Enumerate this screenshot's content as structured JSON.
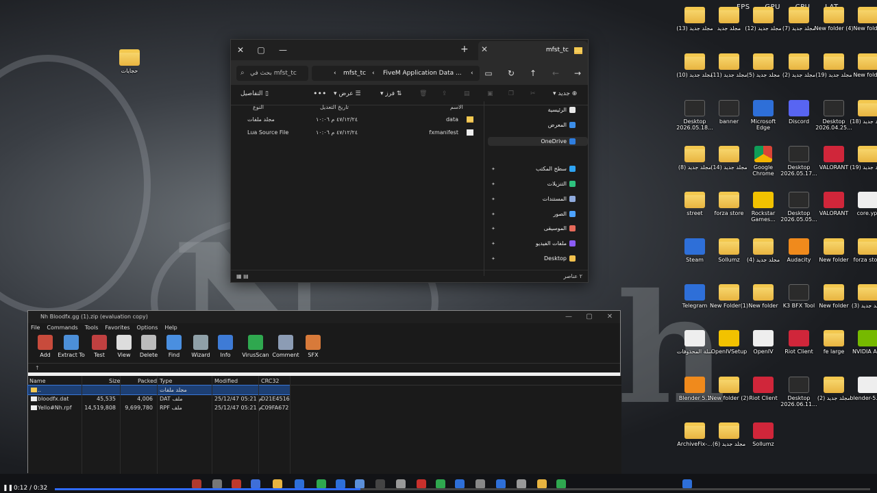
{
  "hud": {
    "fps": "FPS",
    "gpu": "GPU",
    "cpu": "CPU",
    "lat": "LAT"
  },
  "desktop_icons": [
    {
      "label": "حجايات",
      "kind": "folder"
    },
    {
      "label": "مجلد جديد (13)",
      "kind": "folder"
    },
    {
      "label": "مجلد جديد",
      "kind": "folder"
    },
    {
      "label": "مجلد جديد (12)",
      "kind": "folder"
    },
    {
      "label": "مجلد جديد (7)",
      "kind": "folder"
    },
    {
      "label": "New folder (4)",
      "kind": "folder"
    },
    {
      "label": "New folder",
      "kind": "folder"
    },
    {
      "label": "مجلد جديد (10)",
      "kind": "folder"
    },
    {
      "label": "مجلد جديد (11)",
      "kind": "folder"
    },
    {
      "label": "مجلد جديد (5)",
      "kind": "folder"
    },
    {
      "label": "مجلد جديد (2)",
      "kind": "folder"
    },
    {
      "label": "مجلد جديد (19)",
      "kind": "folder"
    },
    {
      "label": "New folder",
      "kind": "folder"
    },
    {
      "label": "Desktop 2026.05.18...",
      "kind": "app-dark"
    },
    {
      "label": "banner",
      "kind": "app-dark"
    },
    {
      "label": "Microsoft Edge",
      "kind": "app-blue"
    },
    {
      "label": "Discord",
      "kind": "app-purple"
    },
    {
      "label": "Desktop 2026.04.25...",
      "kind": "app-dark"
    },
    {
      "label": "مجلد جديد (18)",
      "kind": "folder"
    },
    {
      "label": "مجلد جديد (8)",
      "kind": "folder"
    },
    {
      "label": "مجلد جديد (14)",
      "kind": "folder"
    },
    {
      "label": "Google Chrome",
      "kind": "app-chrome"
    },
    {
      "label": "Desktop 2026.05.17...",
      "kind": "app-dark"
    },
    {
      "label": "VALORANT",
      "kind": "app-red"
    },
    {
      "label": "مجلد جديد (19)",
      "kind": "folder"
    },
    {
      "label": "street",
      "kind": "folder"
    },
    {
      "label": "forza store",
      "kind": "folder"
    },
    {
      "label": "Rockstar Games...",
      "kind": "app-yellow"
    },
    {
      "label": "Desktop 2026.05.05...",
      "kind": "app-dark"
    },
    {
      "label": "VALORANT",
      "kind": "app-red"
    },
    {
      "label": "core.ypt",
      "kind": "app-white"
    },
    {
      "label": "Steam",
      "kind": "app-blue"
    },
    {
      "label": "Sollumz",
      "kind": "folder"
    },
    {
      "label": "مجلد جديد (4)",
      "kind": "folder"
    },
    {
      "label": "Audacity",
      "kind": "app-orange"
    },
    {
      "label": "New folder",
      "kind": "folder"
    },
    {
      "label": "forza store",
      "kind": "folder"
    },
    {
      "label": "Telegram",
      "kind": "app-blue"
    },
    {
      "label": "New Folder(1)",
      "kind": "folder"
    },
    {
      "label": "New folder",
      "kind": "folder"
    },
    {
      "label": "K3 BFX Tool",
      "kind": "app-dark"
    },
    {
      "label": "New folder",
      "kind": "folder"
    },
    {
      "label": "مجلد جديد (3)",
      "kind": "folder"
    },
    {
      "label": "سلة المحذوفات",
      "kind": "app-white"
    },
    {
      "label": "OpenIVSetup",
      "kind": "app-yellow"
    },
    {
      "label": "OpenIV",
      "kind": "app-white"
    },
    {
      "label": "Riot Client",
      "kind": "app-red"
    },
    {
      "label": "fe large",
      "kind": "folder"
    },
    {
      "label": "NVIDIA App",
      "kind": "app-green"
    },
    {
      "label": "Blender 5.1",
      "kind": "app-orange"
    },
    {
      "label": "New folder (2)",
      "kind": "folder"
    },
    {
      "label": "Riot Client",
      "kind": "app-red"
    },
    {
      "label": "Desktop 2026.06.11...",
      "kind": "app-dark"
    },
    {
      "label": "مجلد جديد (2)",
      "kind": "folder"
    },
    {
      "label": "blender-5.1...",
      "kind": "app-white"
    },
    {
      "label": "ArchiveFix-...",
      "kind": "folder"
    },
    {
      "label": "مجلد جديد (6)",
      "kind": "folder"
    },
    {
      "label": "Sollumz",
      "kind": "app-red"
    }
  ],
  "explorer": {
    "tab_title": "mfst_tc",
    "search_placeholder": "بحث في mfst_tc",
    "path": [
      "mfst_tc",
      "FiveM Application Data",
      "..."
    ],
    "cmd": {
      "details": "التفاصيل",
      "view": "عرض",
      "sort": "فرز",
      "new": "جديد"
    },
    "headers": {
      "name": "الاسم",
      "date": "تاريخ التعديل",
      "type": "النوع"
    },
    "files": [
      {
        "name": "data",
        "date": "٤٧/١٢/٢٤ م ١٠:٠٦",
        "type": "مجلد ملفات",
        "icon": "folder"
      },
      {
        "name": "fxmanifest",
        "date": "٤٧/١٢/٢٤ م ١٠:٠٦",
        "type": "Lua Source File",
        "icon": "file"
      }
    ],
    "sidebar": [
      {
        "label": "الرئيسية",
        "color": "#e8e8e8",
        "pin": false
      },
      {
        "label": "المعرض",
        "color": "#3c8ee8",
        "pin": false
      },
      {
        "label": "OneDrive",
        "color": "#2f7ee0",
        "pin": false
      },
      {
        "label": "سطح المكتب",
        "color": "#2ea3f2",
        "pin": true
      },
      {
        "label": "التنزيلات",
        "color": "#2ec27e",
        "pin": true
      },
      {
        "label": "المستندات",
        "color": "#8faadc",
        "pin": true
      },
      {
        "label": "الصور",
        "color": "#4da3ff",
        "pin": true
      },
      {
        "label": "الموسيقى",
        "color": "#e66a5a",
        "pin": true
      },
      {
        "label": "ملفات الفيديو",
        "color": "#8b5cf6",
        "pin": true
      },
      {
        "label": "Desktop",
        "color": "#f2c14e",
        "pin": true
      }
    ],
    "status": "٢ عناصر"
  },
  "winrar": {
    "title": "Nh Bloodfx.gg (1).zip (evaluation copy)",
    "menu": [
      "File",
      "Commands",
      "Tools",
      "Favorites",
      "Options",
      "Help"
    ],
    "tools": [
      {
        "label": "Add",
        "color": "#c84b3c"
      },
      {
        "label": "Extract To",
        "color": "#4c8fd8"
      },
      {
        "label": "Test",
        "color": "#c04040"
      },
      {
        "label": "View",
        "color": "#dddddd"
      },
      {
        "label": "Delete",
        "color": "#bbbbbb"
      },
      {
        "label": "Find",
        "color": "#4a8fe0"
      },
      {
        "label": "Wizard",
        "color": "#8fa0a8"
      },
      {
        "label": "Info",
        "color": "#3e7bd6"
      },
      {
        "label": "VirusScan",
        "color": "#2fa84f"
      },
      {
        "label": "Comment",
        "color": "#8c9cb4"
      },
      {
        "label": "SFX",
        "color": "#d87a3a"
      }
    ],
    "columns": {
      "name": "Name",
      "size": "Size",
      "packed": "Packed",
      "type": "Type",
      "modified": "Modified",
      "crc": "CRC32"
    },
    "rows": [
      {
        "name": "..",
        "size": "",
        "packed": "",
        "type": "مجلد ملفات",
        "modified": "",
        "crc": "",
        "selected": true
      },
      {
        "name": "bloodfx.dat",
        "size": "45,535",
        "packed": "4,006",
        "type": "DAT ملف",
        "modified": "25/12/47 05:21 م",
        "crc": "D21E4516",
        "selected": false
      },
      {
        "name": "Yello#Nh.rpf",
        "size": "14,519,808",
        "packed": "9,699,780",
        "type": "RPF ملف",
        "modified": "25/12/47 05:21 م",
        "crc": "C09FA672",
        "selected": false
      }
    ]
  },
  "player": {
    "time": "0:12 / 0:32",
    "progress": 0.375
  }
}
